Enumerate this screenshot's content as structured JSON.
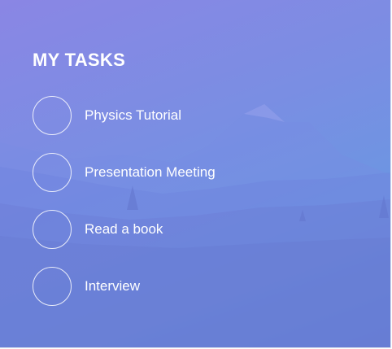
{
  "header": {
    "title": "MY TASKS"
  },
  "tasks": [
    {
      "label": "Physics Tutorial",
      "completed": false
    },
    {
      "label": "Presentation Meeting",
      "completed": false
    },
    {
      "label": "Read a book",
      "completed": false
    },
    {
      "label": "Interview",
      "completed": false
    }
  ],
  "colors": {
    "gradient_start": "#8a86e4",
    "gradient_end": "#5a86d4",
    "text": "#ffffff"
  }
}
